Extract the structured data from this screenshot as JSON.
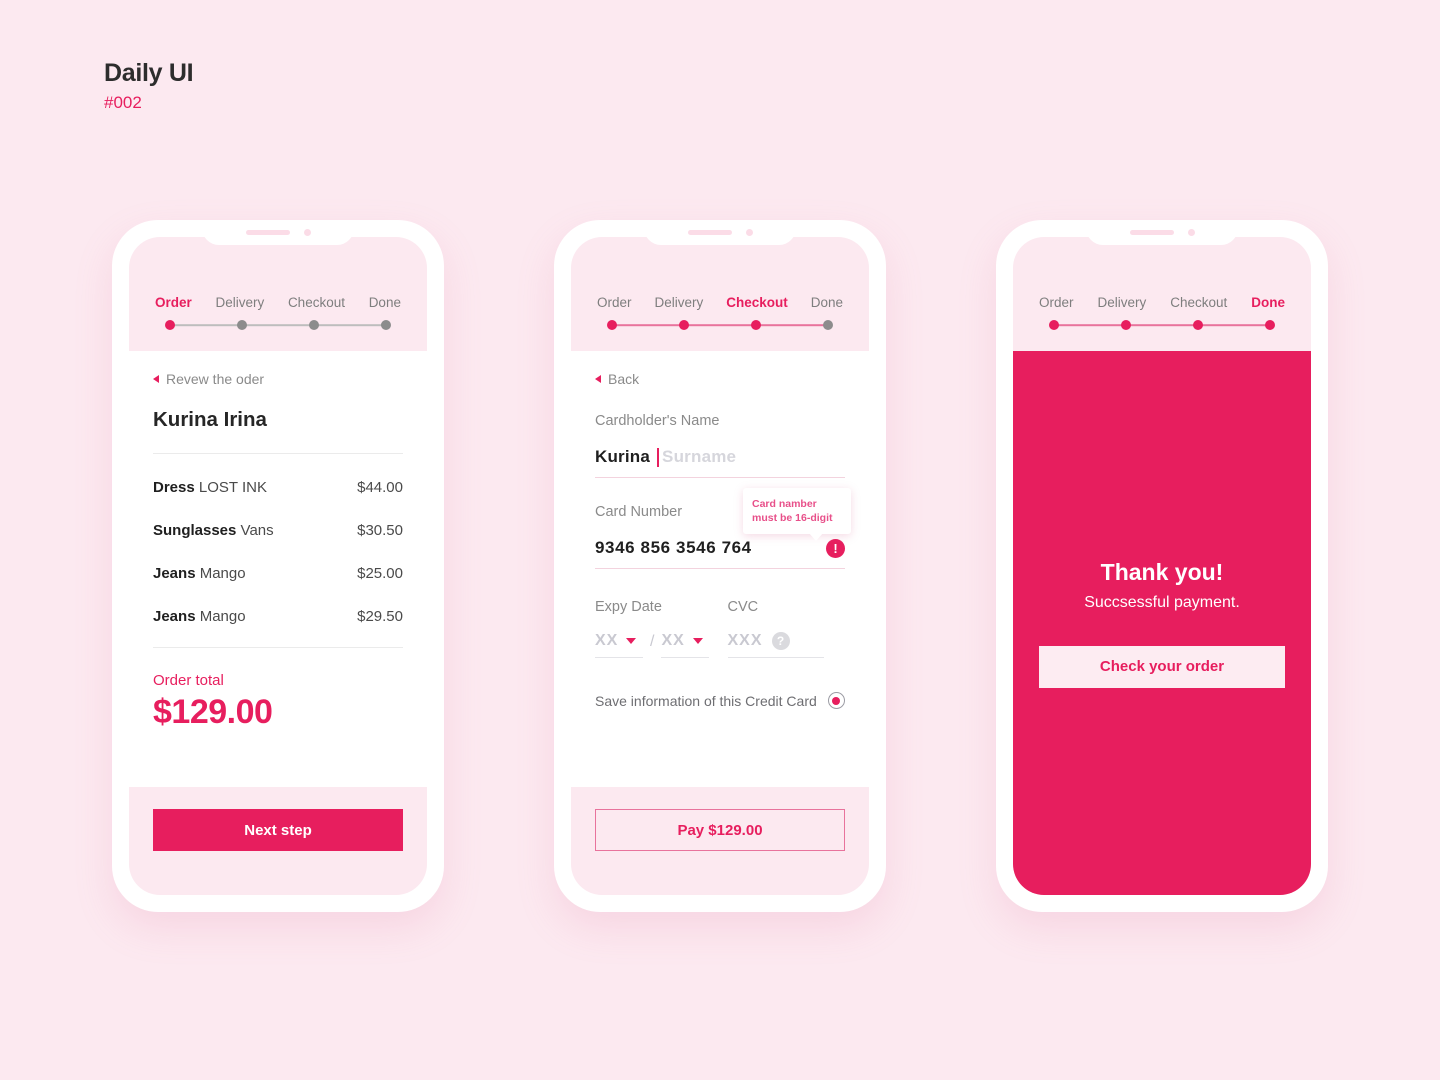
{
  "header": {
    "title": "Daily UI",
    "subtitle": "#002"
  },
  "colors": {
    "accent": "#E71E5E",
    "background": "#FCE9F0",
    "panel_light": "#FCE9F0",
    "muted_text": "#8A8A8A",
    "dot_inactive": "#8C8C8C"
  },
  "steps": [
    "Order",
    "Delivery",
    "Checkout",
    "Done"
  ],
  "phone1": {
    "active_step": "Order",
    "step_states": [
      "on",
      "off",
      "off",
      "off"
    ],
    "line_done": false,
    "back_label": "Revew the oder",
    "back_icon": "triangle-left-icon",
    "customer_name": "Kurina Irina",
    "items": [
      {
        "name": "Dress",
        "brand": "LOST INK",
        "price": "$44.00"
      },
      {
        "name": "Sunglasses",
        "brand": "Vans",
        "price": "$30.50"
      },
      {
        "name": "Jeans",
        "brand": "Mango",
        "price": "$25.00"
      },
      {
        "name": "Jeans",
        "brand": "Mango",
        "price": "$29.50"
      }
    ],
    "total_label": "Order total",
    "total_value": "$129.00",
    "cta": "Next step"
  },
  "phone2": {
    "active_step": "Checkout",
    "step_states": [
      "on",
      "on",
      "on",
      "off"
    ],
    "line_done": true,
    "back_label": "Back",
    "back_icon": "triangle-left-icon",
    "cardholder_label": "Cardholder's Name",
    "cardholder_value": "Kurina",
    "cardholder_placeholder": "Surname",
    "card_number_label": "Card Number",
    "card_number_value": "9346 856 3546 764",
    "error_icon": "exclamation-icon",
    "error_mark": "!",
    "tooltip_line1": "Card namber",
    "tooltip_line2": "must be 16-digit",
    "expiry_label": "Expy Date",
    "expiry_month": "XX",
    "expiry_separator": "/",
    "expiry_year": "XX",
    "cvc_label": "CVC",
    "cvc_value": "XXX",
    "cvc_help": "?",
    "save_label": "Save information of this Credit Card",
    "save_checked": true,
    "cta": "Pay $129.00"
  },
  "phone3": {
    "active_step": "Done",
    "step_states": [
      "on",
      "on",
      "on",
      "on"
    ],
    "line_done": true,
    "title": "Thank you!",
    "subtitle": "Succsessful payment.",
    "cta": "Check your order"
  }
}
